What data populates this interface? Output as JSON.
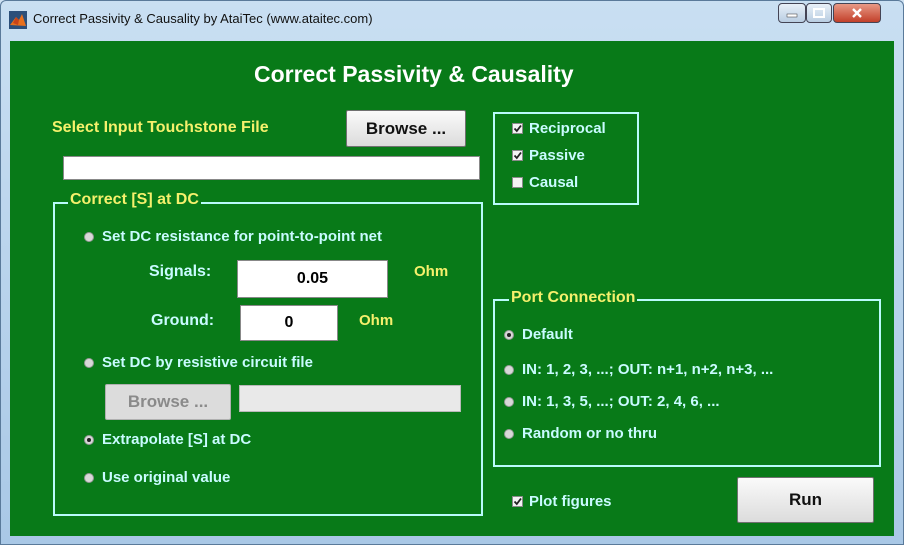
{
  "window": {
    "title": "Correct Passivity & Causality by AtaiTec (www.ataitec.com)"
  },
  "header": {
    "title": "Correct Passivity & Causality"
  },
  "input_file": {
    "label": "Select Input Touchstone File",
    "browse_label": "Browse ...",
    "path_value": ""
  },
  "options": [
    {
      "label": "Reciprocal",
      "checked": true
    },
    {
      "label": "Passive",
      "checked": true
    },
    {
      "label": "Causal",
      "checked": false
    }
  ],
  "dc_group": {
    "title": "Correct [S] at DC",
    "opt_resistance": "Set DC resistance for point-to-point net",
    "signals_label": "Signals:",
    "signals_value": "0.05",
    "signals_unit": "Ohm",
    "ground_label": "Ground:",
    "ground_value": "0",
    "ground_unit": "Ohm",
    "opt_circuit": "Set DC by resistive circuit file",
    "circuit_browse_label": "Browse ...",
    "circuit_path_value": "",
    "opt_extrapolate": "Extrapolate [S] at DC",
    "opt_original": "Use original value",
    "selected": "extrapolate"
  },
  "port_group": {
    "title": "Port Connection",
    "options": [
      "Default",
      "IN: 1, 2, 3, ...;  OUT: n+1, n+2, n+3, ...",
      "IN: 1, 3, 5, ...;  OUT: 2, 4, 6, ...",
      "Random or no thru"
    ],
    "selected_index": 0
  },
  "plot_figures": {
    "label": "Plot figures",
    "checked": true
  },
  "run_label": "Run",
  "colors": {
    "panel_bg": "#087a18",
    "label_yellow": "#f5f06c",
    "frame_cyan": "#b9fbfb"
  }
}
